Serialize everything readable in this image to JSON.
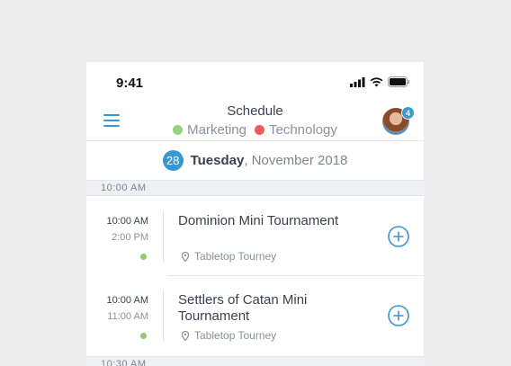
{
  "status_bar": {
    "time": "9:41"
  },
  "header": {
    "title": "Schedule",
    "filters": [
      {
        "label": "Marketing",
        "color": "#97d07e"
      },
      {
        "label": "Technology",
        "color": "#ef5a5a"
      }
    ],
    "notification_count": "4"
  },
  "date": {
    "day": "28",
    "weekday": "Tuesday",
    "rest": ", November 2018"
  },
  "sections": [
    {
      "time": "10:00 AM"
    },
    {
      "time": "10:30 AM"
    }
  ],
  "events": [
    {
      "start": "10:00 AM",
      "end": "2:00 PM",
      "title": "Dominion Mini Tournament",
      "location": "Tabletop Tourney",
      "track_color": "#8ccc6e"
    },
    {
      "start": "10:00 AM",
      "end": "11:00 AM",
      "title": "Settlers of Catan Mini Tournament",
      "location": "Tabletop Tourney",
      "track_color": "#8ccc6e"
    }
  ],
  "colors": {
    "accent": "#3a97d4",
    "background": "#ededed"
  }
}
